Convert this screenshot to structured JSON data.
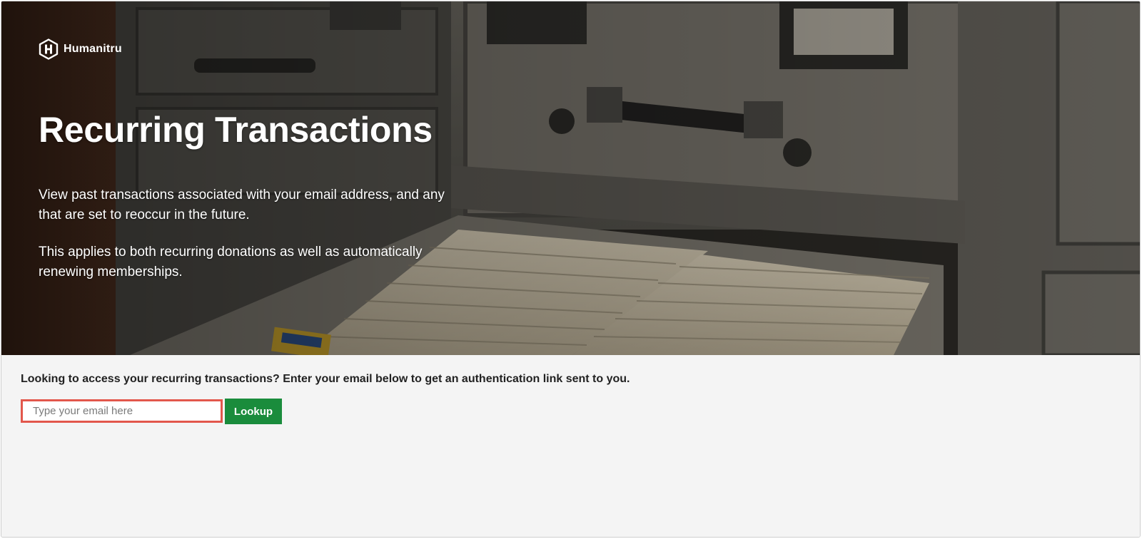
{
  "brand": {
    "name": "Humanitru",
    "logo_icon": "hexagon-h-logo"
  },
  "hero": {
    "title": "Recurring Transactions",
    "paragraph_1": "View past transactions associated with your email address, and any that are set to reoccur in the future.",
    "paragraph_2": "This applies to both recurring donations as well as automatically renewing memberships.",
    "background_description_icon": "file-cabinet-drawer-photo"
  },
  "lookup": {
    "prompt": "Looking to access your recurring transactions? Enter your email below to get an authentication link sent to you.",
    "email_placeholder": "Type your email here",
    "email_value": "",
    "button_label": "Lookup"
  },
  "colors": {
    "accent_button": "#1a8c3c",
    "input_focus_border": "#e2574c",
    "page_background": "#f4f4f4"
  }
}
